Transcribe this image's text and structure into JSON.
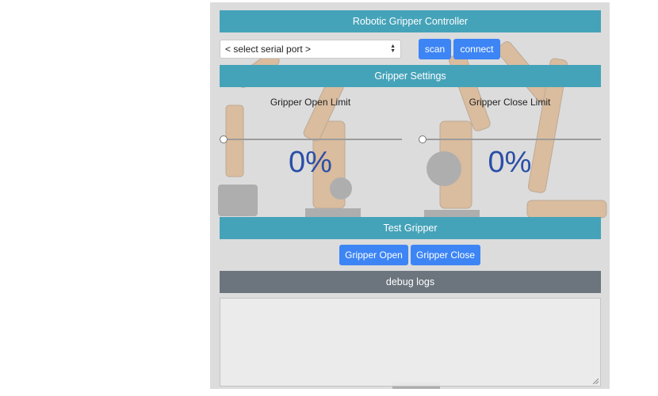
{
  "header": {
    "title": "Robotic Gripper Controller"
  },
  "serial": {
    "port_select_value": "< select serial port >",
    "scan_label": "scan",
    "connect_label": "connect"
  },
  "settings": {
    "title": "Gripper Settings",
    "open_limit": {
      "label": "Gripper Open Limit",
      "value_text": "0%",
      "value": 0
    },
    "close_limit": {
      "label": "Gripper Close Limit",
      "value_text": "0%",
      "value": 0
    }
  },
  "test": {
    "title": "Test Gripper",
    "open_label": "Gripper Open",
    "close_label": "Gripper Close"
  },
  "debug": {
    "title": "debug logs",
    "content": ""
  },
  "colors": {
    "section_header": "#45a3b9",
    "debug_header": "#6c757d",
    "button": "#3d85f5",
    "percent_text": "#2a4fa8"
  }
}
